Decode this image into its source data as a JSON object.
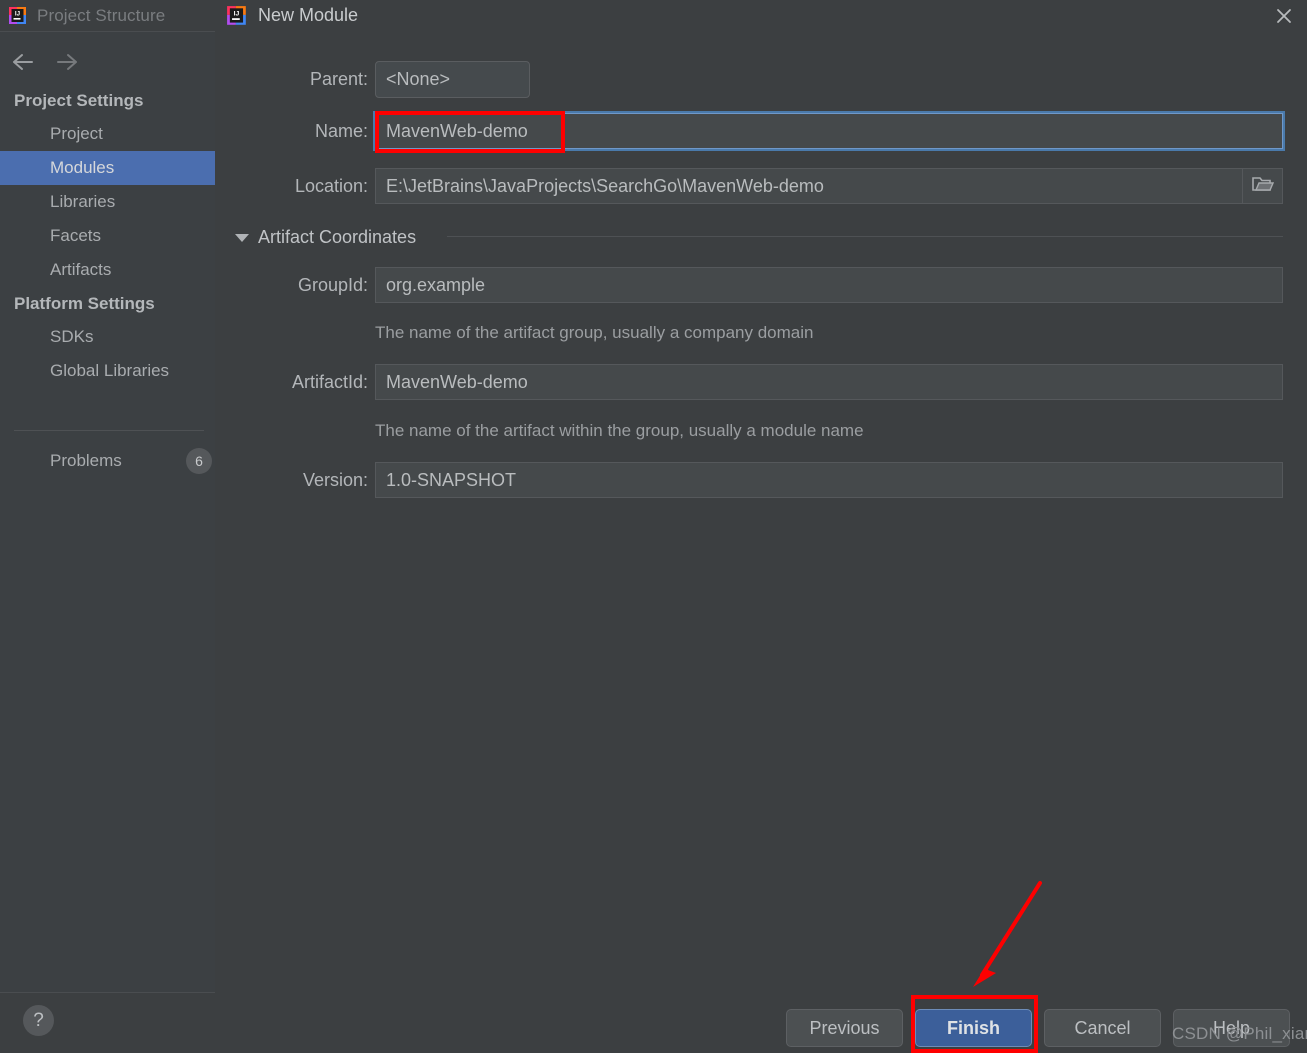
{
  "background_window": {
    "title": "Project Structure",
    "logo_icon": "intellij-idea-logo",
    "nav": {
      "back_icon": "arrow-left-icon",
      "forward_icon": "arrow-right-icon"
    },
    "tree": [
      {
        "label": "Project Settings",
        "type": "group"
      },
      {
        "label": "Project",
        "type": "item",
        "selected": false
      },
      {
        "label": "Modules",
        "type": "item",
        "selected": true
      },
      {
        "label": "Libraries",
        "type": "item",
        "selected": false
      },
      {
        "label": "Facets",
        "type": "item",
        "selected": false
      },
      {
        "label": "Artifacts",
        "type": "item",
        "selected": false
      },
      {
        "label": "Platform Settings",
        "type": "group"
      },
      {
        "label": "SDKs",
        "type": "item",
        "selected": false
      },
      {
        "label": "Global Libraries",
        "type": "item",
        "selected": false
      }
    ],
    "problems": {
      "label": "Problems",
      "count": "6"
    },
    "footer_help": {
      "icon": "question-mark-icon",
      "label": "?"
    }
  },
  "dialog": {
    "title": "New Module",
    "logo_icon": "intellij-idea-logo",
    "close_icon": "close-icon",
    "fields": {
      "parent": {
        "label": "Parent:",
        "value": "<None>",
        "caret_icon": "chevron-down-icon"
      },
      "name": {
        "label": "Name:",
        "value": "MavenWeb-demo"
      },
      "location": {
        "label": "Location:",
        "value": "E:\\JetBrains\\JavaProjects\\SearchGo\\MavenWeb-demo",
        "browse_icon": "folder-icon"
      }
    },
    "artifact_section": {
      "title": "Artifact Coordinates",
      "toggle_icon": "triangle-down-icon",
      "group_id": {
        "label": "GroupId:",
        "value": "org.example",
        "hint": "The name of the artifact group, usually a company domain"
      },
      "artifact_id": {
        "label": "ArtifactId:",
        "value": "MavenWeb-demo",
        "hint": "The name of the artifact within the group, usually a module name"
      },
      "version": {
        "label": "Version:",
        "value": "1.0-SNAPSHOT"
      }
    },
    "buttons": {
      "previous": "Previous",
      "finish": "Finish",
      "cancel": "Cancel",
      "help": "Help"
    }
  },
  "watermark": "CSDN @Phil_xian",
  "annotations": {
    "highlight_color": "#fe0000",
    "name_field_box": "name-field-highlight",
    "finish_button_box": "finish-button-highlight",
    "arrow": "arrow-pointing-to-finish"
  },
  "colors": {
    "dialog_bg": "#3c3f41",
    "selection_blue": "#4b6eaf",
    "primary_button": "#3c5f9a",
    "annotation_red": "#fe0000"
  }
}
